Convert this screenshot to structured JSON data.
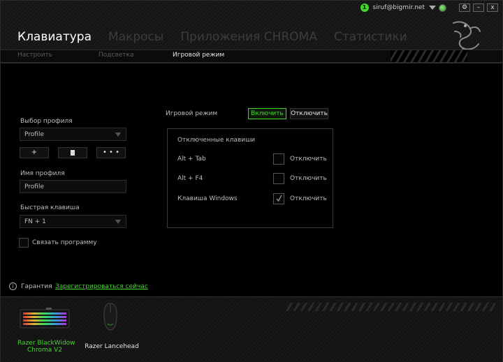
{
  "topbar": {
    "notification_count": "1",
    "email": "siruf@bigmir.net",
    "settings_label": "⚙",
    "minimize_label": "–",
    "close_label": "x"
  },
  "main_tabs": [
    {
      "label": "Клавиатура",
      "active": true
    },
    {
      "label": "Макросы",
      "active": false
    },
    {
      "label": "Приложения CHROMA",
      "active": false
    },
    {
      "label": "Статистики",
      "active": false
    }
  ],
  "sub_tabs": [
    {
      "label": "Настроить",
      "active": false
    },
    {
      "label": "Подсветка",
      "active": false
    },
    {
      "label": "Игровой режим",
      "active": true
    }
  ],
  "profile_panel": {
    "select_label": "Выбор профиля",
    "selected_profile": "Profile",
    "add_button": "+",
    "more_button": "• • •",
    "name_label": "Имя профиля",
    "name_value": "Profile",
    "hotkey_label": "Быстрая клавиша",
    "hotkey_value": "FN + 1",
    "link_program_label": "Связать программу"
  },
  "game_mode": {
    "label": "Игровой режим",
    "on_button": "Включить",
    "off_button": "Отключить",
    "disabled_keys_title": "Отключенные клавиши",
    "rows": [
      {
        "key": "Alt + Tab",
        "option": "Отключить",
        "checked": false
      },
      {
        "key": "Alt + F4",
        "option": "Отключить",
        "checked": false
      },
      {
        "key": "Клавиша Windows",
        "option": "Отключить",
        "checked": true
      }
    ]
  },
  "warranty": {
    "label": "Гарантия",
    "register_link": "Зарегистрироваться сейчас"
  },
  "devices": [
    {
      "name": "Razer BlackWidow Chroma V2",
      "line1": "Razer BlackWidow",
      "line2": "Chroma V2",
      "selected": true
    },
    {
      "name": "Razer Lancehead",
      "line1": "Razer Lancehead",
      "line2": "",
      "selected": false
    }
  ],
  "colors": {
    "accent": "#44d62c",
    "background": "#000000",
    "text": "#bdbdbd"
  }
}
